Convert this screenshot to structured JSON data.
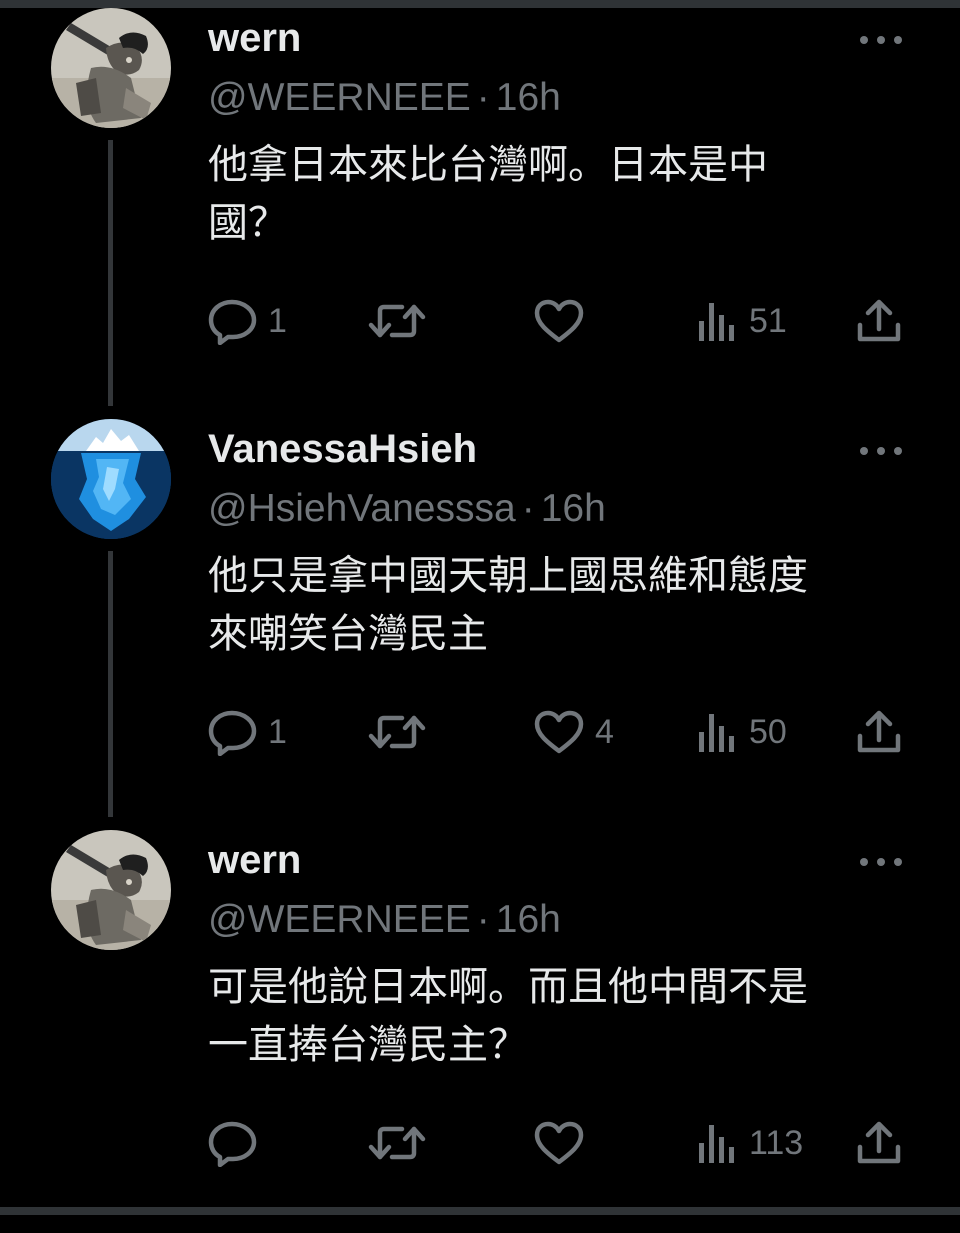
{
  "tweets": [
    {
      "display_name": "wern",
      "handle": "@WEERNEEE",
      "separator": "·",
      "time": "16h",
      "text_line1": "他拿日本來比台灣啊。日本是中",
      "text_line2": "國？",
      "replies": "1",
      "retweets": "",
      "likes": "",
      "views": "51",
      "avatar": "robot-figure-avatar",
      "thread_line": true
    },
    {
      "display_name": "VanessaHsieh",
      "handle": "@HsiehVanesssa",
      "separator": "·",
      "time": "16h",
      "text_line1": "他只是拿中國天朝上國思維和態度",
      "text_line2": "來嘲笑台灣民主",
      "replies": "1",
      "retweets": "",
      "likes": "4",
      "views": "50",
      "avatar": "iceberg-avatar",
      "thread_line": true
    },
    {
      "display_name": "wern",
      "handle": "@WEERNEEE",
      "separator": "·",
      "time": "16h",
      "text_line1": "可是他說日本啊。而且他中間不是",
      "text_line2": "一直捧台灣民主？",
      "replies": "",
      "retweets": "",
      "likes": "",
      "views": "113",
      "avatar": "robot-figure-avatar",
      "thread_line": false
    }
  ],
  "colors": {
    "background": "#000000",
    "primary_text": "#e7e9ea",
    "secondary_text": "#71767b",
    "thread_line": "#333639"
  },
  "icons": [
    "reply-icon",
    "retweet-icon",
    "like-icon",
    "views-icon",
    "share-icon",
    "more-icon"
  ]
}
